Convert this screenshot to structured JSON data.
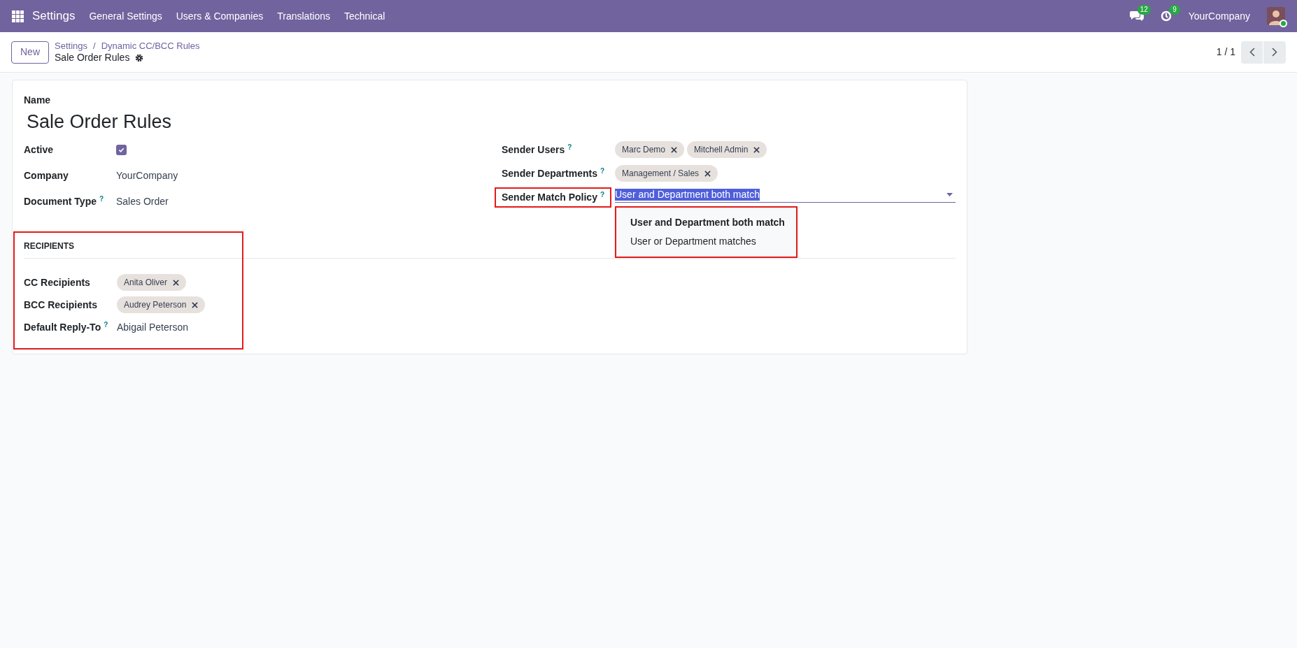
{
  "navbar": {
    "app_title": "Settings",
    "menu": [
      "General Settings",
      "Users & Companies",
      "Translations",
      "Technical"
    ],
    "messages_badge": "12",
    "activities_badge": "9",
    "company": "YourCompany"
  },
  "control_panel": {
    "new_button": "New",
    "breadcrumbs": [
      "Settings",
      "Dynamic CC/BCC Rules"
    ],
    "breadcrumb_separator": "/",
    "record_title": "Sale Order Rules",
    "pager": "1 / 1"
  },
  "form": {
    "name_label": "Name",
    "name_value": "Sale Order Rules",
    "left_fields": [
      {
        "kind": "checkbox",
        "label": "Active",
        "checked": true
      },
      {
        "kind": "text",
        "label": "Company",
        "value": "YourCompany"
      },
      {
        "kind": "text",
        "label": "Document Type",
        "help": "?",
        "value": "Sales Order"
      }
    ],
    "right_fields": [
      {
        "kind": "tags",
        "label": "Sender Users",
        "help": "?",
        "highlighted": false,
        "tags": [
          "Marc Demo",
          "Mitchell Admin"
        ]
      },
      {
        "kind": "tags",
        "label": "Sender Departments",
        "help": "?",
        "highlighted": false,
        "tags": [
          "Management / Sales"
        ]
      },
      {
        "kind": "select",
        "label": "Sender Match Policy",
        "help": "?",
        "highlighted": true,
        "value": "User and Department both match",
        "dropdown_highlighted": true,
        "options": [
          {
            "label": "User and Department both match",
            "selected": true
          },
          {
            "label": "User or Department matches",
            "selected": false
          }
        ]
      }
    ],
    "recipients": {
      "heading": "RECIPIENTS",
      "highlighted": true,
      "fields": [
        {
          "kind": "tags",
          "label": "CC Recipients",
          "tags": [
            "Anita Oliver"
          ]
        },
        {
          "kind": "tags",
          "label": "BCC Recipients",
          "tags": [
            "Audrey Peterson"
          ]
        },
        {
          "kind": "text",
          "label": "Default Reply-To",
          "help": "?",
          "value": "Abigail Peterson"
        }
      ]
    }
  }
}
